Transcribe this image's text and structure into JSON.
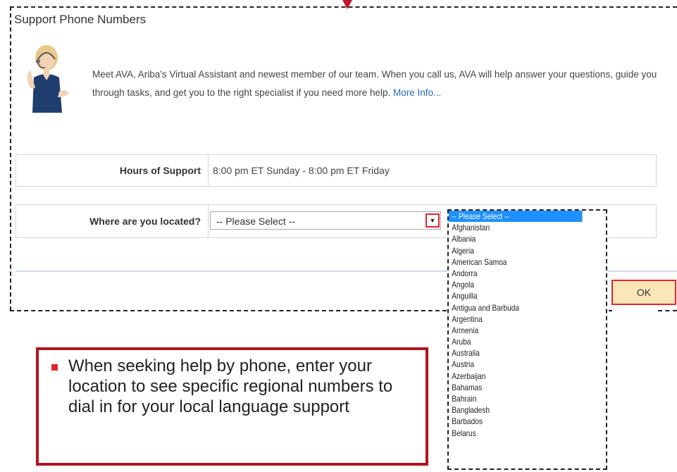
{
  "dialog": {
    "title": "Support Phone Numbers",
    "intro_text": "Meet AVA, Ariba's Virtual Assistant and newest member of our team. When you call us, AVA will help answer your questions, guide you through tasks, and get you to the right specialist if you need more help.",
    "more_info_link": "More Info..."
  },
  "support_hours": {
    "label": "Hours of Support",
    "value": "8:00 pm ET Sunday - 8:00 pm ET Friday"
  },
  "location": {
    "label": "Where are you located?",
    "selected": "-- Please Select --",
    "arrow_glyph": "▼",
    "options": [
      "-- Please Select --",
      "Afghanistan",
      "Albania",
      "Algeria",
      "American Samoa",
      "Andorra",
      "Angola",
      "Anguilla",
      "Antigua and Barbuda",
      "Argentina",
      "Armenia",
      "Aruba",
      "Australia",
      "Austria",
      "Azerbaijan",
      "Bahamas",
      "Bahrain",
      "Bangladesh",
      "Barbados",
      "Belarus"
    ]
  },
  "buttons": {
    "ok_label": "OK"
  },
  "callout": {
    "text": "When seeking help by phone, enter your location to see specific regional numbers to dial in for your local language support"
  },
  "colors": {
    "highlight_red": "#e0262f",
    "callout_border": "#b0141e",
    "ok_button_bg": "#fbe6b8",
    "link": "#2a6ab3",
    "selected_option_bg": "#1e90ff"
  },
  "icons": {
    "avatar": "virtual-assistant-avatar",
    "dropdown": "chevron-down-icon",
    "pointer": "pointer-arrow-icon",
    "bullet": "square-bullet-icon"
  }
}
